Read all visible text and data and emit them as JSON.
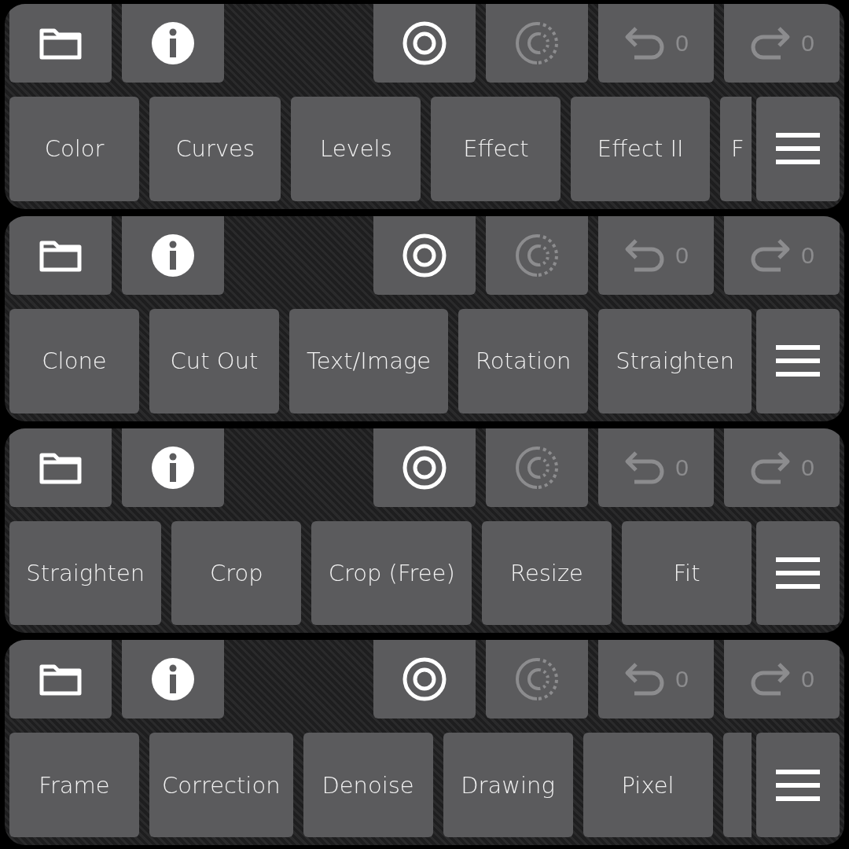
{
  "panels": [
    {
      "toolbar": [
        {
          "kind": "open"
        },
        {
          "kind": "info"
        },
        {
          "kind": "target",
          "disabled": false
        },
        {
          "kind": "history",
          "disabled": true
        },
        {
          "kind": "undo",
          "disabled": true,
          "count": "0"
        },
        {
          "kind": "redo",
          "disabled": true,
          "count": "0"
        }
      ],
      "tools": [
        {
          "kind": "full",
          "label": "Color"
        },
        {
          "kind": "full",
          "label": "Curves"
        },
        {
          "kind": "full",
          "label": "Levels"
        },
        {
          "kind": "full",
          "label": "Effect"
        },
        {
          "kind": "full",
          "label": "Effect II"
        },
        {
          "kind": "clipped",
          "label": "F"
        }
      ]
    },
    {
      "toolbar": [
        {
          "kind": "open"
        },
        {
          "kind": "info"
        },
        {
          "kind": "target",
          "disabled": false
        },
        {
          "kind": "history",
          "disabled": true
        },
        {
          "kind": "undo",
          "disabled": true,
          "count": "0"
        },
        {
          "kind": "redo",
          "disabled": true,
          "count": "0"
        }
      ],
      "tools": [
        {
          "kind": "full",
          "label": "Clone"
        },
        {
          "kind": "full",
          "label": "Cut Out"
        },
        {
          "kind": "full",
          "label": "Text/Image"
        },
        {
          "kind": "full",
          "label": "Rotation"
        },
        {
          "kind": "full",
          "label": "Straighten"
        }
      ]
    },
    {
      "toolbar": [
        {
          "kind": "open"
        },
        {
          "kind": "info"
        },
        {
          "kind": "target",
          "disabled": false
        },
        {
          "kind": "history",
          "disabled": true
        },
        {
          "kind": "undo",
          "disabled": true,
          "count": "0"
        },
        {
          "kind": "redo",
          "disabled": true,
          "count": "0"
        }
      ],
      "tools": [
        {
          "kind": "full",
          "label": "Straighten"
        },
        {
          "kind": "full",
          "label": "Crop"
        },
        {
          "kind": "full",
          "label": "Crop (Free)"
        },
        {
          "kind": "full",
          "label": "Resize"
        },
        {
          "kind": "full",
          "label": "Fit"
        }
      ]
    },
    {
      "toolbar": [
        {
          "kind": "open"
        },
        {
          "kind": "info"
        },
        {
          "kind": "target",
          "disabled": false
        },
        {
          "kind": "history",
          "disabled": true
        },
        {
          "kind": "undo",
          "disabled": true,
          "count": "0"
        },
        {
          "kind": "redo",
          "disabled": true,
          "count": "0"
        }
      ],
      "tools": [
        {
          "kind": "full",
          "label": "Frame"
        },
        {
          "kind": "full",
          "label": "Correction"
        },
        {
          "kind": "full",
          "label": "Denoise"
        },
        {
          "kind": "full",
          "label": "Drawing"
        },
        {
          "kind": "full",
          "label": "Pixel"
        },
        {
          "kind": "clipped"
        }
      ]
    }
  ]
}
